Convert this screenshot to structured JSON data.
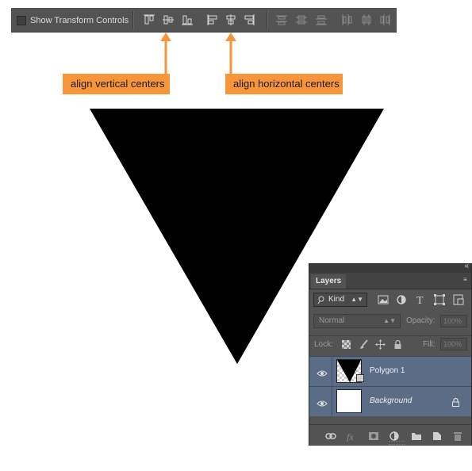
{
  "options_bar": {
    "show_transform_controls": "Show Transform Controls",
    "checkbox_checked": false
  },
  "callouts": {
    "vertical": "align vertical centers",
    "horizontal": "align horizontal centers",
    "color": "#f7953a"
  },
  "layers_panel": {
    "tab": "Layers",
    "filter_kind": "Kind",
    "blend_mode": "Normal",
    "opacity_label": "Opacity:",
    "opacity_value": "100%",
    "lock_label": "Lock:",
    "fill_label": "Fill:",
    "fill_value": "100%",
    "layers": [
      {
        "name": "Polygon 1",
        "visible": true,
        "selected": true
      },
      {
        "name": "Background",
        "visible": true,
        "locked": true
      }
    ]
  },
  "icons": {
    "filter": [
      "image-filter-icon",
      "adjustment-filter-icon",
      "type-filter-icon",
      "shape-filter-icon",
      "smart-object-filter-icon"
    ],
    "locks": [
      "lock-transparent-pixels-icon",
      "lock-image-pixels-icon",
      "lock-position-icon",
      "lock-all-icon"
    ],
    "footer": [
      "link-layers-icon",
      "fx-icon",
      "add-mask-icon",
      "new-adjustment-icon",
      "new-group-icon",
      "new-layer-icon",
      "delete-layer-icon"
    ]
  },
  "colors": {
    "panel": "#535353",
    "selected_layer": "#5b6c86",
    "shape": "#000000"
  }
}
